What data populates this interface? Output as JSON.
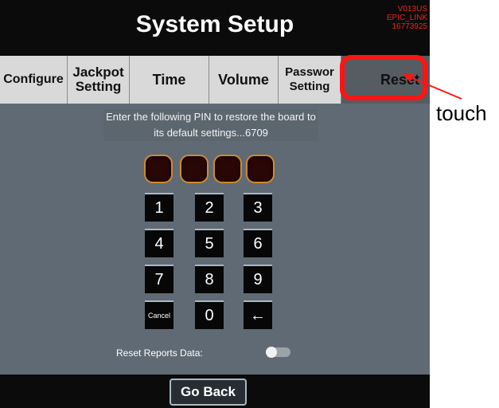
{
  "header": {
    "title": "System Setup",
    "version_lines": [
      "V013US",
      "EPIC_LINK",
      "16773925"
    ]
  },
  "tabs": [
    {
      "label": "Configure",
      "active": false
    },
    {
      "label": "Jackpot\nSetting",
      "active": false
    },
    {
      "label": "Time",
      "active": false
    },
    {
      "label": "Volume",
      "active": false
    },
    {
      "label": "Passwor\nSetting",
      "active": false
    },
    {
      "label": "Reset",
      "active": true
    }
  ],
  "reset_panel": {
    "instruction": "Enter the following PIN to restore the board to its default settings...6709",
    "pin_digits": [
      "",
      "",
      "",
      ""
    ],
    "keypad": [
      "1",
      "2",
      "3",
      "4",
      "5",
      "6",
      "7",
      "8",
      "9",
      "Cancel",
      "0",
      "←"
    ],
    "reset_reports_label": "Reset Reports Data:",
    "reset_reports_enabled": false
  },
  "footer": {
    "go_back_label": "Go Back"
  },
  "annotation": {
    "label": "touch",
    "color": "#ff1414"
  }
}
